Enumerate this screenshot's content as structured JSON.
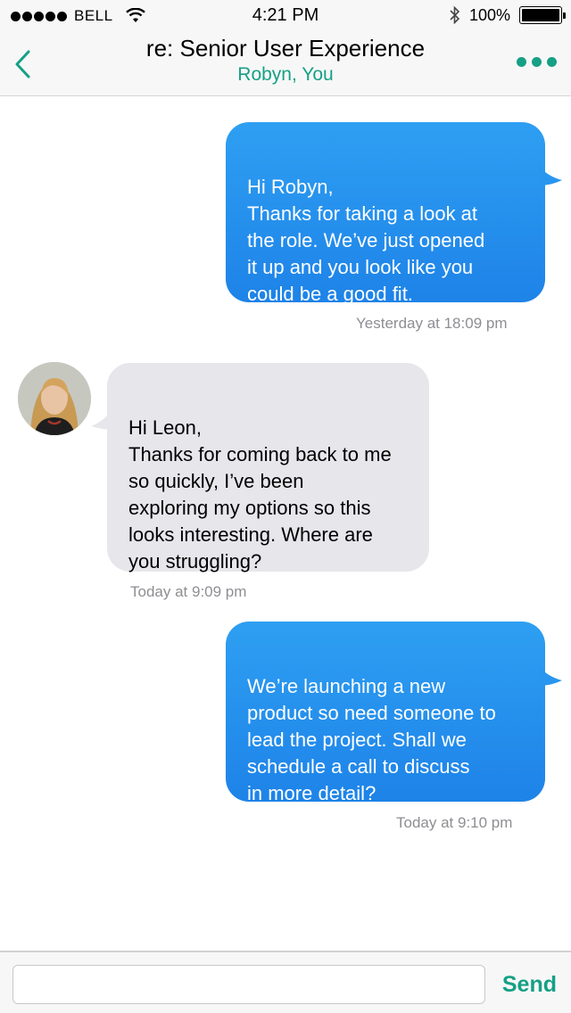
{
  "status_bar": {
    "carrier": "BELL",
    "time": "4:21 PM",
    "battery_percent": "100%"
  },
  "nav": {
    "title": "re: Senior User Experience",
    "subtitle": "Robyn, You"
  },
  "messages": [
    {
      "direction": "outgoing",
      "text": "Hi Robyn,\nThanks for taking a look at\nthe role. We’ve just opened\nit up and you look like you\ncould be a good fit.",
      "timestamp": "Yesterday at 18:09 pm"
    },
    {
      "direction": "incoming",
      "text": "Hi Leon,\nThanks for coming back to me\nso quickly, I’ve been\nexploring my options so this\nlooks interesting. Where are\nyou struggling?",
      "timestamp": "Today at 9:09 pm"
    },
    {
      "direction": "outgoing",
      "text": "We’re launching a new\nproduct so need someone to\nlead the project. Shall we\nschedule a call to discuss\nin more detail?",
      "timestamp": "Today at 9:10 pm"
    }
  ],
  "composer": {
    "placeholder": "",
    "send_label": "Send"
  },
  "colors": {
    "accent": "#16a085",
    "outgoing_bubble": "#2196F3",
    "incoming_bubble": "#e6e6eb"
  },
  "icons": {
    "back": "chevron-left-icon",
    "more": "more-dots-icon",
    "wifi": "wifi-icon",
    "bluetooth": "bluetooth-icon",
    "battery": "battery-icon"
  }
}
